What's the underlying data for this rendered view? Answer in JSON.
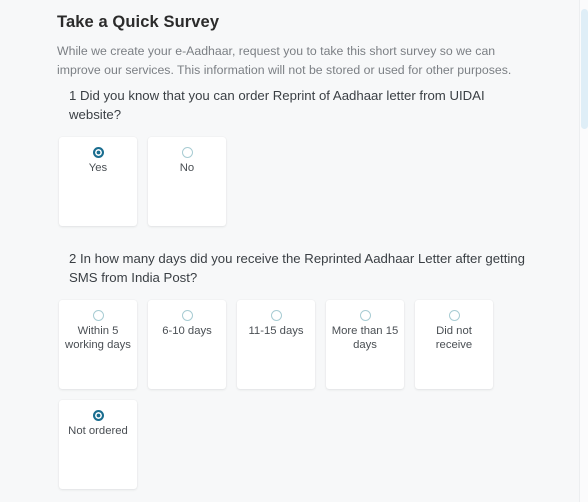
{
  "page": {
    "background_color": "#f7f8f9",
    "accent_color": "#1a6d8f",
    "radio_outline_color": "#a8ccd3"
  },
  "survey": {
    "title": "Take a Quick Survey",
    "description": "While we create your e-Aadhaar, request you to take this short survey so we can improve our services. This information will not be stored or used for other purposes.",
    "questions": [
      {
        "number": "1",
        "text": "1 Did you know that you can order Reprint of Aadhaar letter from UIDAI website?",
        "options": [
          {
            "label": "Yes",
            "selected": true
          },
          {
            "label": "No",
            "selected": false
          }
        ]
      },
      {
        "number": "2",
        "text": "2 In how many days did you receive the Reprinted Aadhaar Letter after getting SMS from India Post?",
        "options": [
          {
            "label": "Within 5 working days",
            "selected": false
          },
          {
            "label": "6-10 days",
            "selected": false
          },
          {
            "label": "11-15 days",
            "selected": false
          },
          {
            "label": "More than 15 days",
            "selected": false
          },
          {
            "label": "Did not receive",
            "selected": false
          },
          {
            "label": "Not ordered",
            "selected": true
          }
        ]
      }
    ]
  },
  "scrollbar": {
    "orientation": "vertical",
    "thumb_color": "#dfeef7"
  }
}
